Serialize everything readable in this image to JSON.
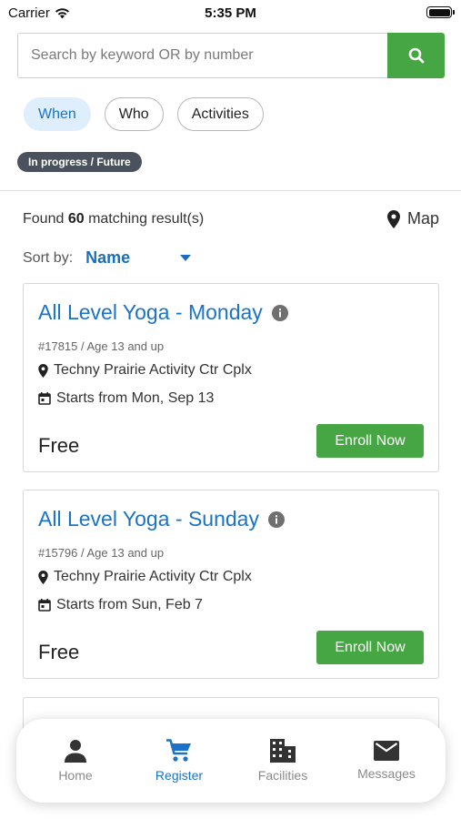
{
  "status_bar": {
    "carrier": "Carrier",
    "time": "5:35 PM"
  },
  "search": {
    "placeholder": "Search by keyword OR by number",
    "value": ""
  },
  "filters": [
    {
      "label": "When",
      "active": true
    },
    {
      "label": "Who",
      "active": false
    },
    {
      "label": "Activities",
      "active": false
    }
  ],
  "status_badge": "In progress / Future",
  "results": {
    "prefix": "Found",
    "count": "60",
    "suffix": "matching result(s)",
    "map_label": "Map"
  },
  "sort": {
    "label": "Sort by:",
    "value": "Name"
  },
  "activities": [
    {
      "title": "All Level Yoga - Monday",
      "meta": "#17815 / Age 13 and up",
      "location": "Techny Prairie Activity Ctr Cplx",
      "start": "Starts from Mon, Sep 13",
      "price": "Free",
      "button": "Enroll Now"
    },
    {
      "title": "All Level Yoga - Sunday",
      "meta": "#15796 / Age 13 and up",
      "location": "Techny Prairie Activity Ctr Cplx",
      "start": "Starts from Sun, Feb 7",
      "price": "Free",
      "button": "Enroll Now"
    }
  ],
  "tabs": [
    {
      "label": "Home",
      "icon": "person-icon",
      "active": false
    },
    {
      "label": "Register",
      "icon": "cart-icon",
      "active": true
    },
    {
      "label": "Facilities",
      "icon": "building-icon",
      "active": false
    },
    {
      "label": "Messages",
      "icon": "mail-icon",
      "active": false
    }
  ],
  "colors": {
    "accent": "#1a73c8",
    "primary_button": "#47a644",
    "badge": "#4a535d",
    "chip_active_bg": "#dfeefc"
  }
}
